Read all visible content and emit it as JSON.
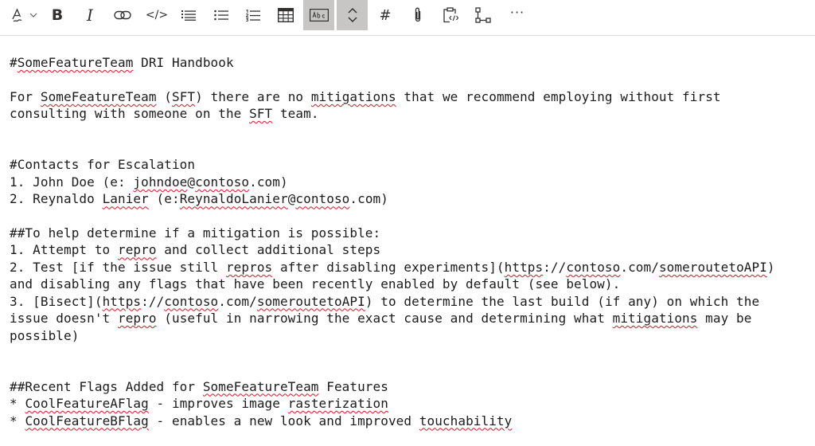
{
  "toolbar": {
    "tools": [
      "text-format",
      "bold",
      "italic",
      "link",
      "code",
      "quote",
      "bulleted-list",
      "numbered-list",
      "table",
      "spell-check",
      "expand-collapse",
      "heading",
      "attachment",
      "paste-code",
      "diagram",
      "more"
    ],
    "bold_label": "B",
    "italic_label": "I",
    "code_label": "</>",
    "heading_label": "#",
    "more_label": "···",
    "active_color": "#c8c6c4"
  },
  "editor": {
    "line_01": "#SomeFeatureTeam DRI Handbook",
    "line_03": "For SomeFeatureTeam (SFT) there are no mitigations that we recommend employing without first",
    "line_04": "consulting with someone on the SFT team.",
    "line_07": "#Contacts for Escalation",
    "line_08": "1. John Doe (e: johndoe@contoso.com)",
    "line_09": "2. Reynaldo Lanier (e:ReynaldoLanier@contoso.com)",
    "line_11": "##To help determine if a mitigation is possible:",
    "line_12": "1. Attempt to repro and collect additional steps",
    "line_13": "2. Test [if the issue still repros after disabling experiments](https://contoso.com/someroutetoAPI)",
    "line_14": "and disabling any flags that have been recently enabled by default (see below).",
    "line_15": "3. [Bisect](https://contoso.com/someroutetoAPI) to determine the last build (if any) on which the",
    "line_16": "issue doesn't repro (useful in narrowing the exact cause and determining what mitigations may be",
    "line_17": "possible)",
    "line_20": "##Recent Flags Added for SomeFeatureTeam Features",
    "line_21": "* CoolFeatureAFlag - improves image rasterization",
    "line_22": "* CoolFeatureBFlag - enables a new look and improved touchability",
    "spell_error_color": "#e81123"
  }
}
